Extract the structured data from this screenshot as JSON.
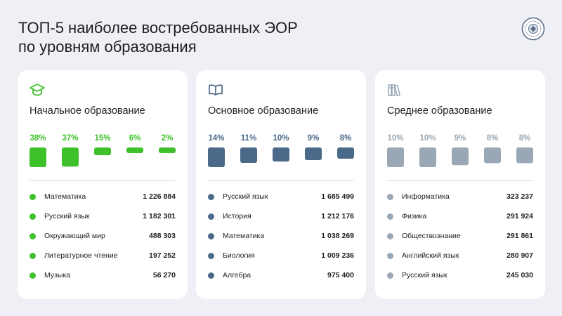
{
  "header": {
    "title_line1": "ТОП-5 наиболее востребованных ЭОР",
    "title_line2": "по уровням образования"
  },
  "chart_data": [
    {
      "type": "bar",
      "title": "Начальное образование",
      "icon": "graduation-cap-icon",
      "color": "#3ec12a",
      "categories": [
        "Математика",
        "Русский язык",
        "Окружающий мир",
        "Литературное чтение",
        "Музыка"
      ],
      "percents": [
        "38%",
        "37%",
        "15%",
        "6%",
        "2%"
      ],
      "values": [
        38,
        37,
        15,
        6,
        2
      ],
      "counts": [
        "1 226 884",
        "1 182 301",
        "488 303",
        "197 252",
        "56 270"
      ]
    },
    {
      "type": "bar",
      "title": "Основное образование",
      "icon": "open-book-icon",
      "color": "#4b6a8a",
      "categories": [
        "Русский язык",
        "История",
        "Математика",
        "Биология",
        "Алгебра"
      ],
      "percents": [
        "14%",
        "11%",
        "10%",
        "9%",
        "8%"
      ],
      "values": [
        14,
        11,
        10,
        9,
        8
      ],
      "counts": [
        "1 685 499",
        "1 212 176",
        "1 038 269",
        "1 009 236",
        "975 400"
      ]
    },
    {
      "type": "bar",
      "title": "Среднее образование",
      "icon": "books-icon",
      "color": "#9aa7b4",
      "categories": [
        "Информатика",
        "Физика",
        "Обществознание",
        "Английский язык",
        "Русский язык"
      ],
      "percents": [
        "10%",
        "10%",
        "9%",
        "8%",
        "8%"
      ],
      "values": [
        10,
        10,
        9,
        8,
        8
      ],
      "counts": [
        "323 237",
        "291 924",
        "291 861",
        "280 907",
        "245 030"
      ]
    }
  ]
}
